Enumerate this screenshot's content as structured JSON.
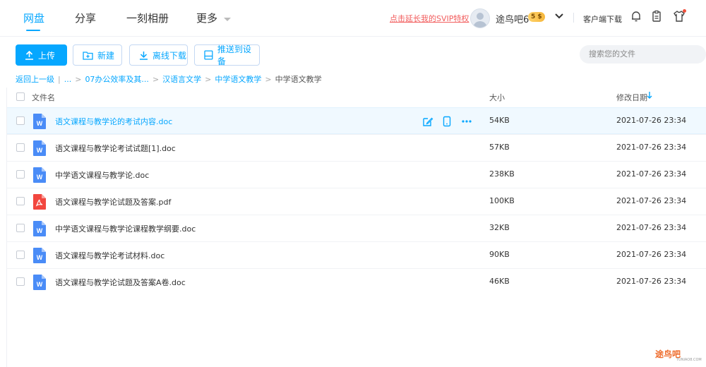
{
  "nav": {
    "items": [
      {
        "label": "网盘",
        "active": true
      },
      {
        "label": "分享",
        "active": false
      },
      {
        "label": "一刻相册",
        "active": false
      },
      {
        "label": "更多",
        "active": false
      }
    ]
  },
  "header": {
    "svip_link": "点击延长我的SVIP特权",
    "username": "途鸟吧6",
    "badge": "5 $",
    "client_download": "客户端下载"
  },
  "toolbar": {
    "upload": "上传",
    "new": "新建",
    "offline_download": "离线下载",
    "push_device": "推送到设备",
    "search_placeholder": "搜索您的文件"
  },
  "breadcrumb": {
    "back": "返回上一级",
    "ellipsis": "...",
    "crumbs": [
      "07办公效率及其...",
      "汉语言文学",
      "中学语文教学"
    ],
    "current": "中学语文教学"
  },
  "table": {
    "col_name": "文件名",
    "col_size": "大小",
    "col_date": "修改日期",
    "sort_icon": "arrow-down-icon",
    "rows": [
      {
        "name": "语文课程与教学论的考试内容.doc",
        "size": "54KB",
        "date": "2021-07-26 23:34",
        "type": "word",
        "hover": true
      },
      {
        "name": "语文课程与教学论考试试题[1].doc",
        "size": "57KB",
        "date": "2021-07-26 23:34",
        "type": "word",
        "hover": false
      },
      {
        "name": "中学语文课程与教学论.doc",
        "size": "238KB",
        "date": "2021-07-26 23:34",
        "type": "word",
        "hover": false
      },
      {
        "name": "语文课程与教学论试题及答案.pdf",
        "size": "100KB",
        "date": "2021-07-26 23:34",
        "type": "pdf",
        "hover": false
      },
      {
        "name": "中学语文课程与教学论课程教学纲要.doc",
        "size": "32KB",
        "date": "2021-07-26 23:34",
        "type": "word",
        "hover": false
      },
      {
        "name": "语文课程与教学论考试材料.doc",
        "size": "90KB",
        "date": "2021-07-26 23:34",
        "type": "word",
        "hover": false
      },
      {
        "name": "语文课程与教学论试题及答案A卷.doc",
        "size": "46KB",
        "date": "2021-07-26 23:34",
        "type": "word",
        "hover": false
      }
    ]
  },
  "watermark": {
    "text": "途鸟吧",
    "sub": "TUNIAO8.COM"
  },
  "colors": {
    "accent": "#06a7ff",
    "svip": "#f25d5d",
    "word": "#4a8cf7",
    "pdf": "#f2473f"
  }
}
